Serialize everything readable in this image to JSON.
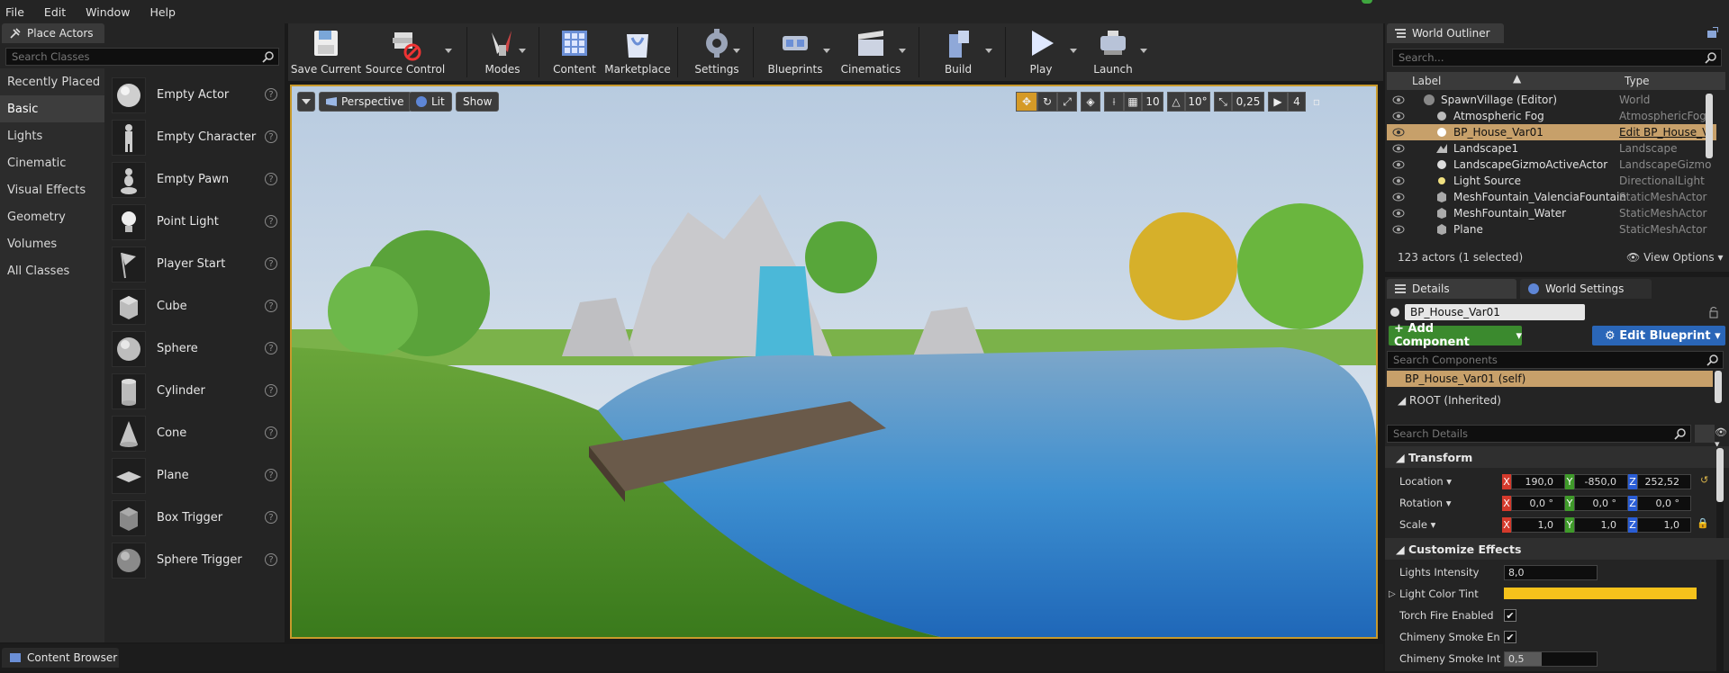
{
  "menu": {
    "items": [
      "File",
      "Edit",
      "Window",
      "Help"
    ]
  },
  "place_actors": {
    "tab_title": "Place Actors",
    "search_placeholder": "Search Classes",
    "categories": [
      "Recently Placed",
      "Basic",
      "Lights",
      "Cinematic",
      "Visual Effects",
      "Geometry",
      "Volumes",
      "All Classes"
    ],
    "active_category": "Basic",
    "actors": [
      "Empty Actor",
      "Empty Character",
      "Empty Pawn",
      "Point Light",
      "Player Start",
      "Cube",
      "Sphere",
      "Cylinder",
      "Cone",
      "Plane",
      "Box Trigger",
      "Sphere Trigger"
    ],
    "help_glyph": "?"
  },
  "toolbar": {
    "buttons": [
      {
        "label": "Save Current",
        "icon": "save-icon"
      },
      {
        "label": "Source Control",
        "icon": "source-control-icon"
      },
      {
        "label": "Modes",
        "icon": "modes-icon"
      },
      {
        "label": "Content",
        "icon": "content-icon"
      },
      {
        "label": "Marketplace",
        "icon": "marketplace-icon"
      },
      {
        "label": "Settings",
        "icon": "settings-icon"
      },
      {
        "label": "Blueprints",
        "icon": "blueprints-icon"
      },
      {
        "label": "Cinematics",
        "icon": "cinematics-icon"
      },
      {
        "label": "Build",
        "icon": "build-icon"
      },
      {
        "label": "Play",
        "icon": "play-icon"
      },
      {
        "label": "Launch",
        "icon": "launch-icon"
      }
    ]
  },
  "viewport": {
    "perspective_label": "Perspective",
    "lit_label": "Lit",
    "show_label": "Show",
    "grid_snap": "10",
    "rotation_snap": "10°",
    "scale_snap": "0,25",
    "camera_speed": "4"
  },
  "outliner": {
    "tab_title": "World Outliner",
    "search_placeholder": "Search...",
    "col_label": "Label",
    "col_type": "Type",
    "rows": [
      {
        "label": "SpawnVillage (Editor)",
        "type": "World"
      },
      {
        "label": "Atmospheric Fog",
        "type": "AtmosphericFog"
      },
      {
        "label": "BP_House_Var01",
        "type": "Edit BP_House_V",
        "selected": true
      },
      {
        "label": "Landscape1",
        "type": "Landscape"
      },
      {
        "label": "LandscapeGizmoActiveActor",
        "type": "LandscapeGizmo"
      },
      {
        "label": "Light Source",
        "type": "DirectionalLight"
      },
      {
        "label": "MeshFountain_ValenciaFountain",
        "type": "StaticMeshActor"
      },
      {
        "label": "MeshFountain_Water",
        "type": "StaticMeshActor"
      },
      {
        "label": "Plane",
        "type": "StaticMeshActor"
      }
    ],
    "status": "123 actors (1 selected)",
    "view_options": "View Options"
  },
  "details": {
    "tab_details": "Details",
    "tab_world_settings": "World Settings",
    "actor_name": "BP_House_Var01",
    "add_component": "+ Add Component",
    "edit_blueprint": "Edit Blueprint",
    "search_components_placeholder": "Search Components",
    "self_component": "BP_House_Var01 (self)",
    "root_component": "ROOT (Inherited)",
    "search_details_placeholder": "Search Details",
    "transform_header": "Transform",
    "location_label": "Location",
    "rotation_label": "Rotation",
    "scale_label": "Scale",
    "location": {
      "x": "190,0",
      "y": "-850,0",
      "z": "252,52"
    },
    "rotation": {
      "x": "0,0 °",
      "y": "0,0 °",
      "z": "0,0 °"
    },
    "scale": {
      "x": "1,0",
      "y": "1,0",
      "z": "1,0"
    },
    "customize_header": "Customize Effects",
    "lights_intensity_label": "Lights Intensity",
    "lights_intensity": "8,0",
    "light_color_tint_label": "Light Color Tint",
    "light_color_tint": "#f5c21b",
    "torch_fire_label": "Torch Fire Enabled",
    "chimney_smoke_enabled_label": "Chimeny Smoke Enabl",
    "chimney_smoke_intensity_label": "Chimeny Smoke Inten",
    "chimney_smoke_intensity": "0,5",
    "check": "✔"
  },
  "content_browser": {
    "tab_title": "Content Browser"
  },
  "colors": {
    "accent": "#c89a2c",
    "add_component": "#3b8a2e",
    "edit_blueprint": "#2a66b8",
    "selected_row": "#c7a06a"
  }
}
